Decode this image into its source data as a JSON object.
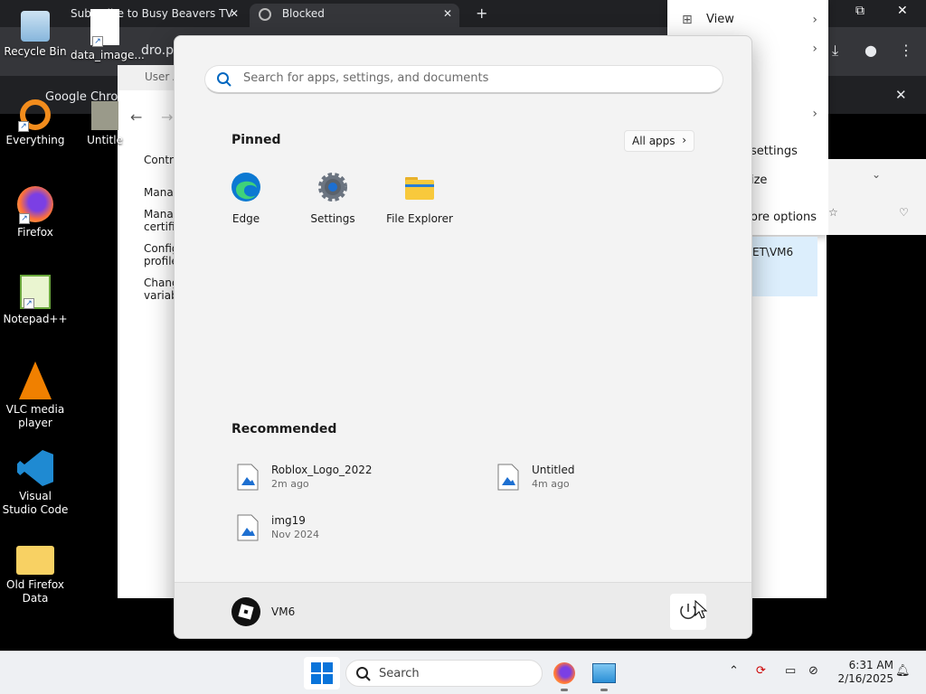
{
  "chrome": {
    "tab1_title": "Subscribe to Busy Beavers TV fo",
    "tab2_title": "Blocked",
    "address_fragment": "dro.p",
    "bookmark_item": "Google Chrom"
  },
  "desktop": {
    "icons": [
      {
        "label": "Recycle Bin"
      },
      {
        "label": "data_image..."
      },
      {
        "label": "Everything"
      },
      {
        "label": "Untitle"
      },
      {
        "label": "Firefox"
      },
      {
        "label": "Notepad++"
      },
      {
        "label": "VLC media player"
      },
      {
        "label": "Visual Studio Code"
      },
      {
        "label": "Old Firefox Data"
      }
    ]
  },
  "control_panel": {
    "header": "User A",
    "items": [
      "Contro",
      "Manag",
      "Manag certific",
      "Config profile",
      "Chang variab"
    ],
    "selected_fragment": "ET\\VM6"
  },
  "side_menu": {
    "view": "View",
    "settings_fragment": "settings",
    "size_fragment": "ize",
    "more_options_fragment": "ore options"
  },
  "start_menu": {
    "search_placeholder": "Search for apps, settings, and documents",
    "pinned_title": "Pinned",
    "all_apps_label": "All apps",
    "pinned": [
      {
        "label": "Edge",
        "icon": "edge-icon"
      },
      {
        "label": "Settings",
        "icon": "gear-icon"
      },
      {
        "label": "File Explorer",
        "icon": "folder-icon"
      }
    ],
    "recommended_title": "Recommended",
    "recommended": [
      {
        "name": "Roblox_Logo_2022",
        "time": "2m ago"
      },
      {
        "name": "Untitled",
        "time": "4m ago"
      },
      {
        "name": "img19",
        "time": "Nov 2024"
      }
    ],
    "user_name": "VM6"
  },
  "taskbar": {
    "search_label": "Search",
    "time": "6:31 AM",
    "date": "2/16/2025"
  },
  "colors": {
    "accent": "#0067c0",
    "taskbar_bg": "#eef0f3",
    "start_bg": "#f3f3f3"
  }
}
